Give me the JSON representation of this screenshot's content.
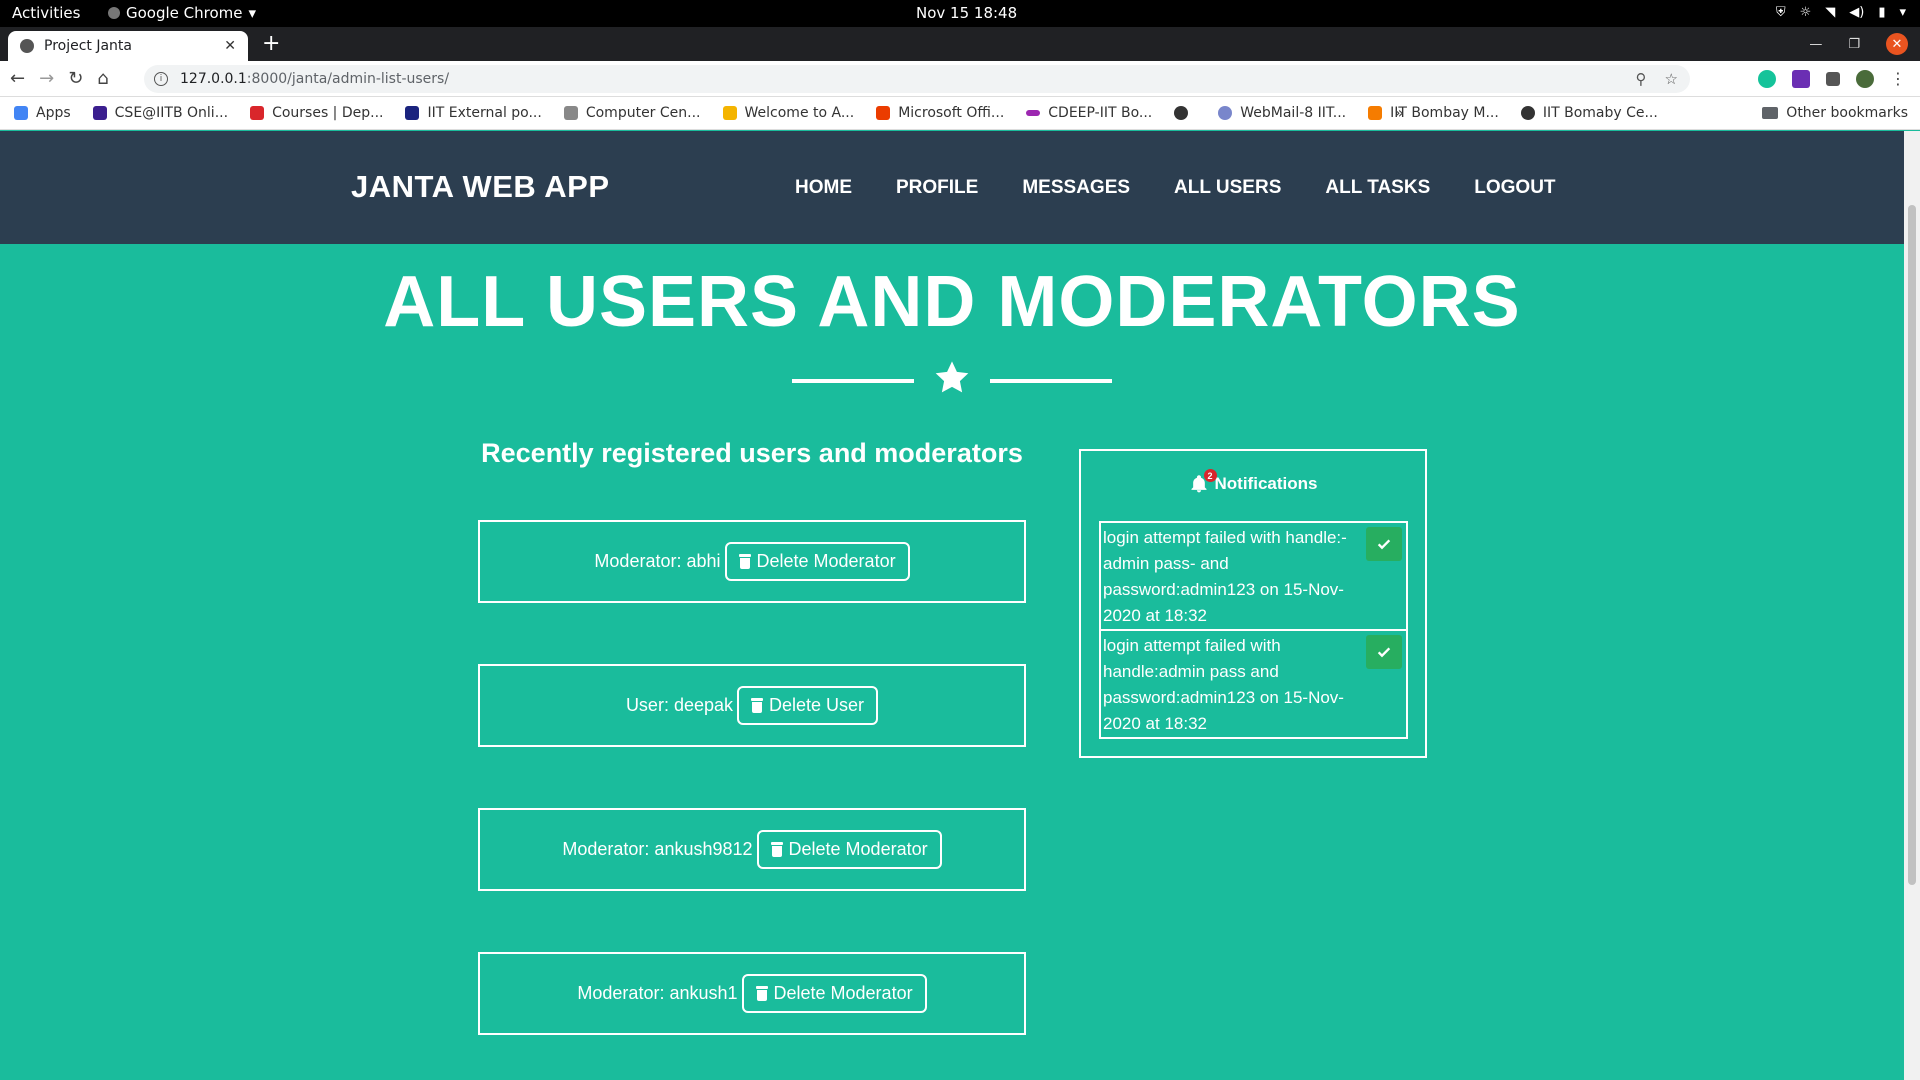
{
  "os": {
    "activities": "Activities",
    "app_name": "Google Chrome",
    "clock": "Nov 15  18:48"
  },
  "browser": {
    "tab_title": "Project Janta",
    "url_host": "127.0.0.1",
    "url_path": ":8000/janta/admin-list-users/",
    "bookmarks": [
      "Apps",
      "CSE@IITB Onli...",
      "Courses | Dep...",
      "IIT External po...",
      "Computer Cen...",
      "Welcome to A...",
      "Microsoft Offi...",
      "CDEEP-IIT Bo...",
      "",
      "WebMail-8 IIT...",
      "IIT Bombay M...",
      "IIT Bomaby Ce..."
    ],
    "more_bookmarks": "»",
    "other_bookmarks": "Other bookmarks"
  },
  "navbar": {
    "brand": "JANTA WEB APP",
    "links": [
      "HOME",
      "PROFILE",
      "MESSAGES",
      "ALL USERS",
      "ALL TASKS",
      "LOGOUT"
    ]
  },
  "page": {
    "heading": "ALL USERS AND MODERATORS",
    "subheading": "Recently registered users and moderators"
  },
  "users": [
    {
      "label": "Moderator: abhi",
      "button": "Delete Moderator"
    },
    {
      "label": "User: deepak",
      "button": "Delete User"
    },
    {
      "label": "Moderator: ankush9812",
      "button": "Delete Moderator"
    },
    {
      "label": "Moderator: ankush1",
      "button": "Delete Moderator"
    }
  ],
  "notifications": {
    "title": "Notifications",
    "count": "2",
    "items": [
      "login attempt failed with handle:-admin pass- and password:admin123 on 15-Nov-2020 at 18:32",
      "login attempt failed with handle:admin pass and password:admin123 on 15-Nov-2020 at 18:32"
    ]
  },
  "colors": {
    "page_bg": "#1abc9c",
    "navbar_bg": "#2c3e50",
    "check_green": "#27ae60",
    "badge_red": "#d9262b"
  }
}
